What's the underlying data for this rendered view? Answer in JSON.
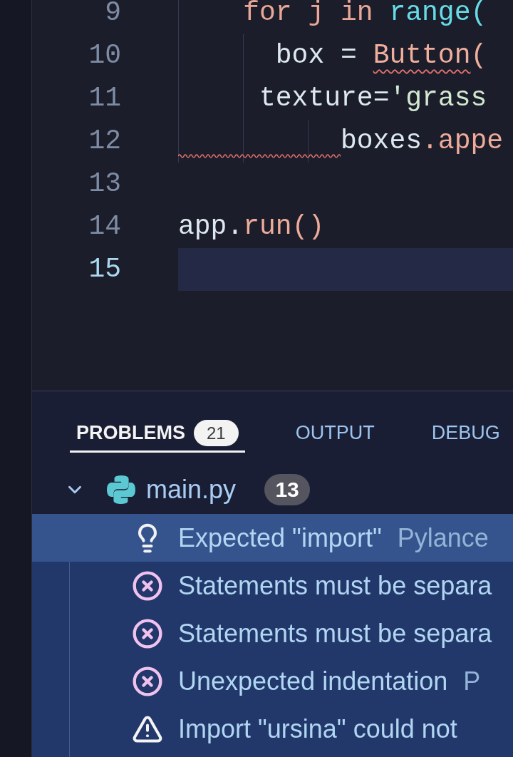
{
  "editor": {
    "lines": [
      {
        "number": "9",
        "current": false,
        "indent_squiggle": false,
        "tokens": [
          {
            "text": "    for j in ",
            "kind": "keyword",
            "squiggle": false
          },
          {
            "text": "range(",
            "kind": "builtin",
            "squiggle": false
          }
        ]
      },
      {
        "number": "10",
        "current": false,
        "indent_squiggle": false,
        "tokens": [
          {
            "text": "      box = ",
            "kind": "plain",
            "squiggle": false
          },
          {
            "text": "Button",
            "kind": "class",
            "squiggle": true
          },
          {
            "text": "(",
            "kind": "class",
            "squiggle": false
          }
        ]
      },
      {
        "number": "11",
        "current": false,
        "indent_squiggle": false,
        "tokens": [
          {
            "text": "     texture=",
            "kind": "plain",
            "squiggle": false
          },
          {
            "text": "'grass",
            "kind": "string",
            "squiggle": false
          }
        ]
      },
      {
        "number": "12",
        "current": false,
        "indent_squiggle": true,
        "tokens": [
          {
            "text": "          boxes",
            "kind": "plain",
            "squiggle": false
          },
          {
            "text": ".appe",
            "kind": "method",
            "squiggle": false
          }
        ]
      },
      {
        "number": "13",
        "current": false,
        "indent_squiggle": false
      },
      {
        "number": "14",
        "current": false,
        "indent_squiggle": false,
        "tokens": [
          {
            "text": "app.",
            "kind": "plain",
            "squiggle": false
          },
          {
            "text": "run()",
            "kind": "method",
            "squiggle": false
          }
        ]
      },
      {
        "number": "15",
        "current": true,
        "indent_squiggle": false
      }
    ]
  },
  "panel": {
    "tabs": [
      {
        "label": "PROBLEMS",
        "badge": "21",
        "selected": true
      },
      {
        "label": "OUTPUT",
        "selected": false
      },
      {
        "label": "DEBUG",
        "selected": false
      }
    ],
    "file": {
      "name": "main.py",
      "count": "13",
      "expanded": true,
      "problems": [
        {
          "kind": "hint",
          "message": "Expected \"import\"",
          "source": "Pylance",
          "selected": true
        },
        {
          "kind": "error",
          "message": "Statements must be separa",
          "selected": false
        },
        {
          "kind": "error",
          "message": "Statements must be separa",
          "selected": false
        },
        {
          "kind": "error",
          "message": "Unexpected indentation",
          "source": "P",
          "selected": false
        },
        {
          "kind": "warning",
          "message": "Import \"ursina\" could not",
          "selected": false
        }
      ]
    }
  }
}
